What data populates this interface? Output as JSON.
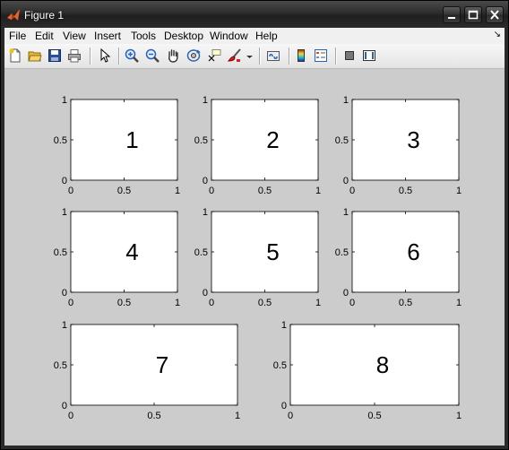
{
  "window": {
    "title": "Figure 1"
  },
  "menu": [
    "File",
    "Edit",
    "View",
    "Insert",
    "Tools",
    "Desktop",
    "Window",
    "Help"
  ],
  "menu_dock_glyph": "↘",
  "toolbar_icons": [
    "new-figure-icon",
    "open-file-icon",
    "save-icon",
    "print-icon",
    "pointer-icon",
    "zoom-in-icon",
    "zoom-out-icon",
    "pan-hand-icon",
    "rotate-3d-icon",
    "data-cursor-icon",
    "brush-icon",
    "brush-dropdown-icon",
    "link-plot-icon",
    "colorbar-icon",
    "legend-icon",
    "hide-plot-tools-icon",
    "show-plot-tools-icon"
  ],
  "subplots": [
    {
      "label": "1",
      "xticks": [
        "0",
        "0.5",
        "1"
      ],
      "yticks": [
        "0",
        "0.5",
        "1"
      ]
    },
    {
      "label": "2",
      "xticks": [
        "0",
        "0.5",
        "1"
      ],
      "yticks": [
        "0",
        "0.5",
        "1"
      ]
    },
    {
      "label": "3",
      "xticks": [
        "0",
        "0.5",
        "1"
      ],
      "yticks": [
        "0",
        "0.5",
        "1"
      ]
    },
    {
      "label": "4",
      "xticks": [
        "0",
        "0.5",
        "1"
      ],
      "yticks": [
        "0",
        "0.5",
        "1"
      ]
    },
    {
      "label": "5",
      "xticks": [
        "0",
        "0.5",
        "1"
      ],
      "yticks": [
        "0",
        "0.5",
        "1"
      ]
    },
    {
      "label": "6",
      "xticks": [
        "0",
        "0.5",
        "1"
      ],
      "yticks": [
        "0",
        "0.5",
        "1"
      ]
    },
    {
      "label": "7",
      "xticks": [
        "0",
        "0.5",
        "1"
      ],
      "yticks": [
        "0",
        "0.5",
        "1"
      ]
    },
    {
      "label": "8",
      "xticks": [
        "0",
        "0.5",
        "1"
      ],
      "yticks": [
        "0",
        "0.5",
        "1"
      ]
    }
  ]
}
